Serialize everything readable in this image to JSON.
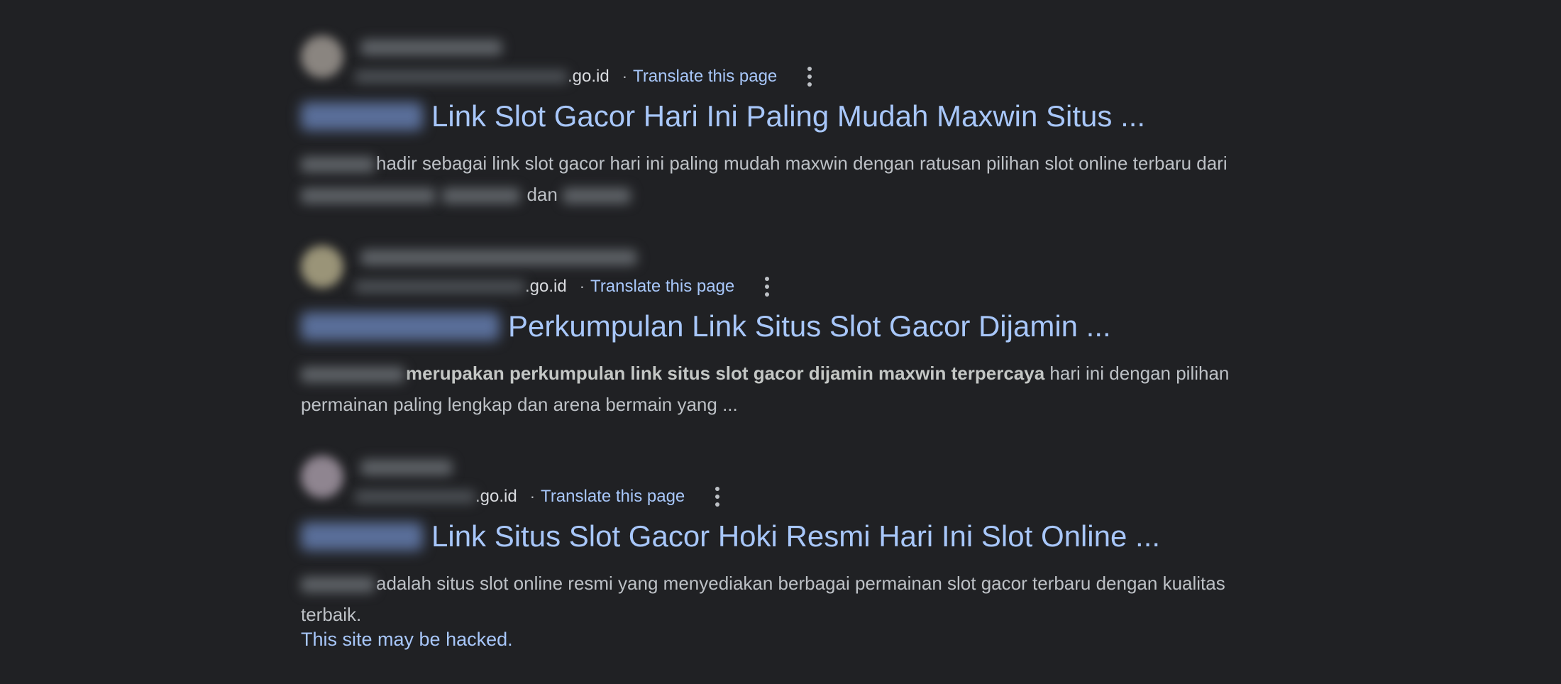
{
  "results": [
    {
      "domain_suffix": ".go.id",
      "dot": "·",
      "translate": "Translate this page",
      "title": "Link Slot Gacor Hari Ini Paling Mudah Maxwin Situs ...",
      "snippet_text_1": "hadir sebagai link slot gacor hari ini paling mudah maxwin dengan ratusan pilihan slot online terbaru dari",
      "snippet_text_2": "dan",
      "favicon_color": "#8a8580"
    },
    {
      "domain_suffix": ".go.id",
      "dot": "·",
      "translate": "Translate this page",
      "title": "Perkumpulan Link Situs Slot Gacor Dijamin ...",
      "snippet_bold": "merupakan perkumpulan link situs slot gacor dijamin maxwin terpercaya",
      "snippet_text": "hari ini dengan pilihan permainan paling lengkap dan arena bermain yang ...",
      "favicon_color": "#9a9478"
    },
    {
      "domain_suffix": ".go.id",
      "dot": "·",
      "translate": "Translate this page",
      "title": "Link Situs Slot Gacor Hoki Resmi Hari Ini Slot Online ...",
      "snippet_text": "adalah situs slot online resmi yang menyediakan berbagai permainan slot gacor terbaru dengan kualitas terbaik.",
      "warning": "This site may be hacked.",
      "favicon_color": "#8f8590"
    }
  ],
  "colors": {
    "background": "#202124",
    "link": "#a8c7fa",
    "snippet": "#bdc1c6"
  }
}
